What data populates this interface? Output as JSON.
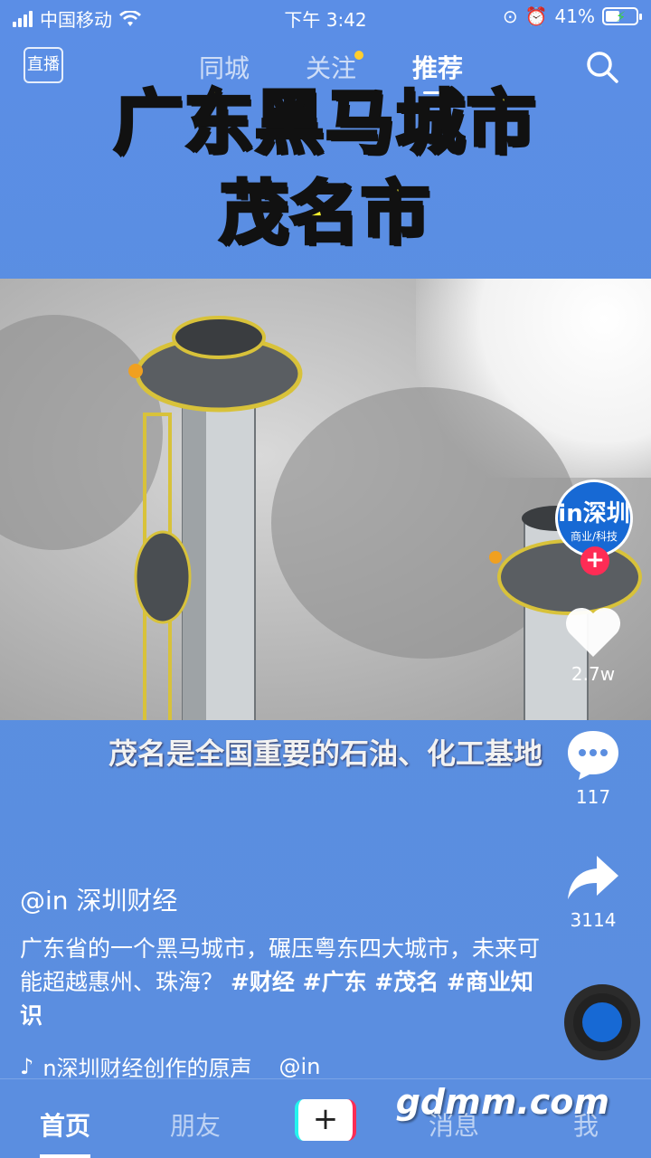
{
  "status": {
    "carrier": "中国移动",
    "time": "下午 3:42",
    "battery": "41%"
  },
  "topnav": {
    "live": "直播",
    "tabs": [
      "同城",
      "关注",
      "推荐"
    ]
  },
  "title": {
    "line1": "广东黑马城市",
    "line2": "茂名市"
  },
  "caption": "茂名是全国重要的石油、化工基地",
  "rail": {
    "avatar_line1": "in深圳",
    "avatar_line2": "商业/科技",
    "likes": "2.7w",
    "comments": "117",
    "shares": "3114"
  },
  "info": {
    "author": "@in 深圳财经",
    "desc": "广东省的一个黑马城市，碾压粤东四大城市，未来可能超越惠州、珠海？",
    "tags": "#财经 #广东 #茂名 #商业知识",
    "sound": "n深圳财经创作的原声",
    "sound_author": "@in"
  },
  "bottom": {
    "home": "首页",
    "friends": "朋友",
    "messages": "消息",
    "me": "我"
  },
  "watermark": "gdmm.com"
}
